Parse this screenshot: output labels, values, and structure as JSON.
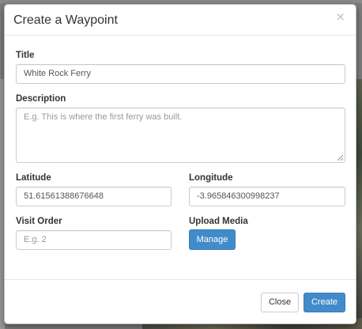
{
  "modal": {
    "title": "Create a Waypoint",
    "close_glyph": "×"
  },
  "form": {
    "title_label": "Title",
    "title_value": "White Rock Ferry",
    "description_label": "Description",
    "description_placeholder": "E.g. This is where the first ferry was built.",
    "latitude_label": "Latitude",
    "latitude_value": "51.61561388676648",
    "longitude_label": "Longitude",
    "longitude_value": "-3.965846300998237",
    "visit_order_label": "Visit Order",
    "visit_order_placeholder": "E.g. 2",
    "upload_media_label": "Upload Media",
    "manage_button": "Manage"
  },
  "footer": {
    "close_button": "Close",
    "create_button": "Create"
  },
  "colors": {
    "primary": "#428bca",
    "backdrop": "#7d7d7d"
  }
}
